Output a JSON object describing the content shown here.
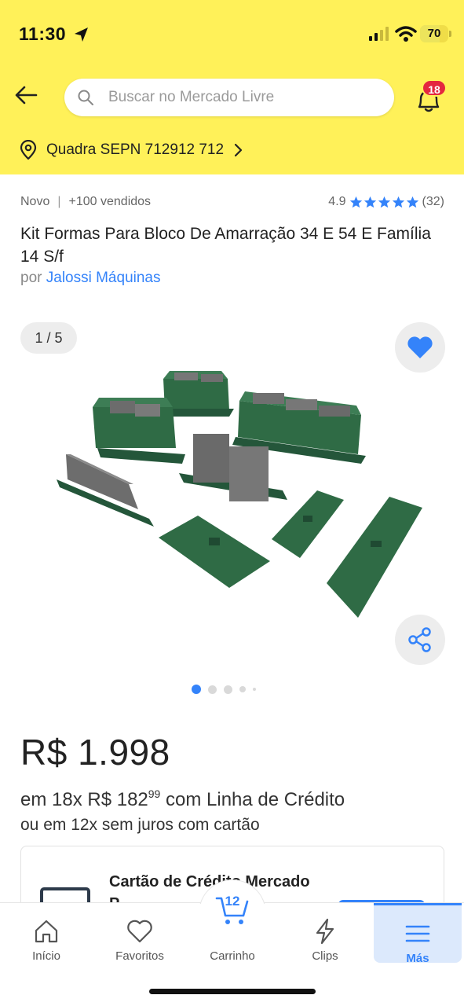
{
  "status_bar": {
    "time": "11:30",
    "battery": "70",
    "battery_level": 0.7
  },
  "header": {
    "search_placeholder": "Buscar no Mercado Livre",
    "notification_count": "18",
    "address": "Quadra SEPN 712912 712"
  },
  "product": {
    "condition": "Novo",
    "sold": "+100 vendidos",
    "rating": "4.9",
    "stars": 5,
    "reviews": "(32)",
    "title": "Kit Formas Para Bloco De Amarração 34 E 54 E Família 14 S/f",
    "seller_prefix": "por",
    "seller": "Jalossi Máquinas",
    "image_counter": "1 / 5",
    "image_total": 5,
    "image_current": 1
  },
  "pricing": {
    "price": "R$ 1.998",
    "inst_prefix": "em 18x R$ 182",
    "inst_cents": "99",
    "inst_suffix": "com Linha de Crédito",
    "no_interest": "ou em 12x sem juros com cartão"
  },
  "card_offer": {
    "title": "Cartão de Crédito Mercado",
    "title2": "P..."
  },
  "bottom_nav": {
    "home": "Início",
    "favorites": "Favoritos",
    "cart": "Carrinho",
    "cart_count": "12",
    "clips": "Clips",
    "more": "Más"
  },
  "colors": {
    "brand_yellow": "#fff159",
    "accent_blue": "#3483fa",
    "badge_red": "#e4283f",
    "product_green": "#2f6b45"
  }
}
